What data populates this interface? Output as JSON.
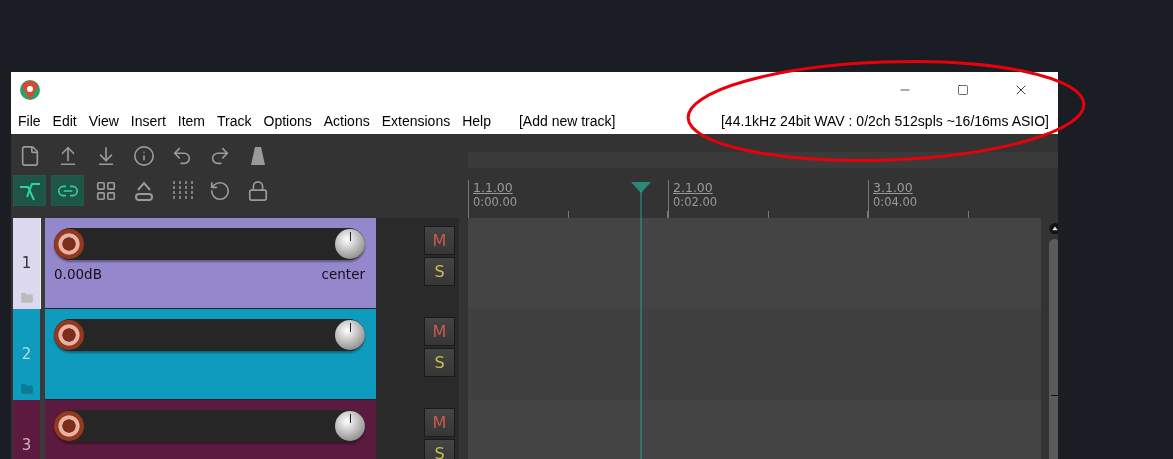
{
  "menu": [
    {
      "label": "File"
    },
    {
      "label": "Edit"
    },
    {
      "label": "View"
    },
    {
      "label": "Insert"
    },
    {
      "label": "Item"
    },
    {
      "label": "Track"
    },
    {
      "label": "Options"
    },
    {
      "label": "Actions"
    },
    {
      "label": "Extensions"
    },
    {
      "label": "Help"
    }
  ],
  "add_track": "[Add new track]",
  "status": "[44.1kHz 24bit WAV : 0/2ch 512spls ~16/16ms ASIO]",
  "toolbar": {
    "rows": [
      [
        {
          "kind": "new",
          "on": false
        },
        {
          "kind": "open",
          "on": false
        },
        {
          "kind": "save",
          "on": false
        },
        {
          "kind": "info",
          "on": false
        },
        {
          "kind": "undo",
          "on": false
        },
        {
          "kind": "redo",
          "on": false
        },
        {
          "kind": "metronome",
          "on": false
        }
      ],
      [
        {
          "kind": "ripple",
          "on": true
        },
        {
          "kind": "link",
          "on": true
        },
        {
          "kind": "grid",
          "on": false
        },
        {
          "kind": "envelope",
          "on": false
        },
        {
          "kind": "gridlines",
          "on": false
        },
        {
          "kind": "loop",
          "on": false
        },
        {
          "kind": "lock",
          "on": false
        }
      ]
    ]
  },
  "ruler": [
    {
      "bar": "1.1.00",
      "time": "0:00.00"
    },
    {
      "bar": "2.1.00",
      "time": "0:02.00"
    },
    {
      "bar": "3.1.00",
      "time": "0:04.00"
    }
  ],
  "tracks": [
    {
      "number": "1",
      "color": "#9587cc",
      "selected": true,
      "folder_icon": true,
      "volume": "0.00dB",
      "pan": "center",
      "mute": "M",
      "solo": "S"
    },
    {
      "number": "2",
      "color": "#0e9bbd",
      "selected": false,
      "folder_icon": true,
      "mute": "M",
      "solo": "S"
    },
    {
      "number": "3",
      "color": "#5c1a3e",
      "selected": false,
      "mute": "M",
      "solo": "S"
    }
  ]
}
